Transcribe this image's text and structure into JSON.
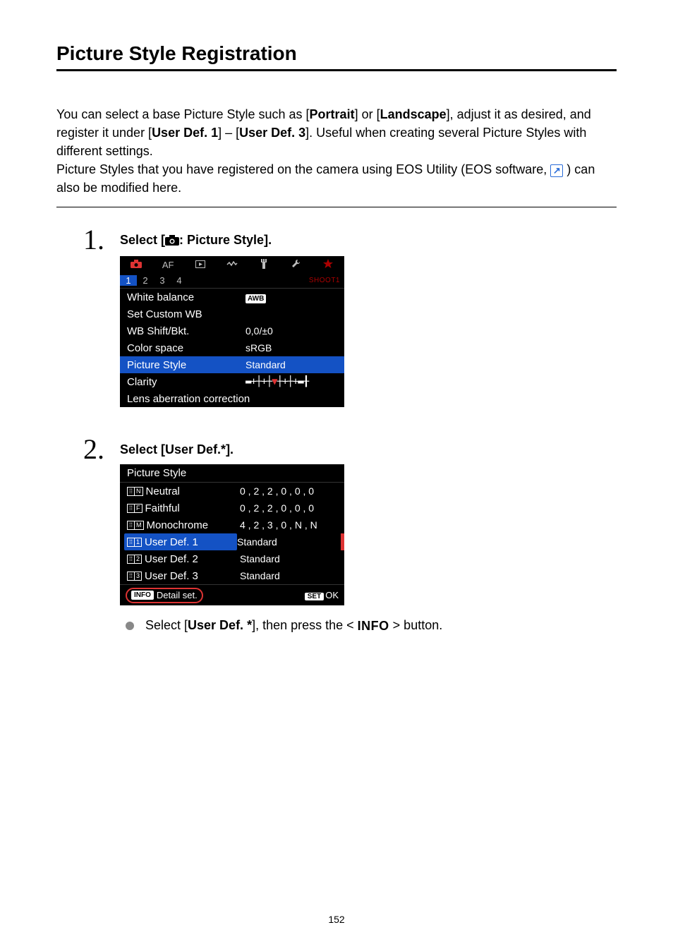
{
  "title": "Picture Style Registration",
  "intro": {
    "p1a": "You can select a base Picture Style such as [",
    "p1b": "Portrait",
    "p1c": "] or [",
    "p1d": "Landscape",
    "p1e": "], adjust it as desired, and register it under [",
    "p1f": "User Def. 1",
    "p1g": "] – [",
    "p1h": "User Def. 3",
    "p1i": "]. Useful when creating several Picture Styles with different settings.",
    "p2a": "Picture Styles that you have registered on the camera using EOS Utility (EOS software, ",
    "p2b": " ) can also be modified here."
  },
  "step1": {
    "num": "1.",
    "title_a": "Select [",
    "title_b": ": Picture Style]."
  },
  "lcd1": {
    "tabs": [
      "camera",
      "AF",
      "play",
      "wave",
      "plug",
      "wrench",
      "star"
    ],
    "subtabs": [
      "1",
      "2",
      "3",
      "4"
    ],
    "shoot": "SHOOT1",
    "rows": [
      {
        "label": "White balance",
        "value_type": "awb",
        "value": "AWB"
      },
      {
        "label": "Set Custom WB",
        "value_type": "none",
        "value": ""
      },
      {
        "label": "WB Shift/Bkt.",
        "value_type": "text",
        "value": "0,0/±0"
      },
      {
        "label": "Color space",
        "value_type": "text",
        "value": "sRGB"
      },
      {
        "label": "Picture Style",
        "value_type": "text",
        "value": "Standard",
        "selected": true
      },
      {
        "label": "Clarity",
        "value_type": "slider",
        "value": ""
      },
      {
        "label": "Lens aberration correction",
        "value_type": "none",
        "value": ""
      }
    ]
  },
  "step2": {
    "num": "2.",
    "title": "Select [User Def.*]."
  },
  "lcd2": {
    "title": "Picture Style",
    "rows": [
      {
        "badge": "N",
        "label": "Neutral",
        "value": "0 , 2 , 2 , 0 , 0 , 0"
      },
      {
        "badge": "F",
        "label": "Faithful",
        "value": "0 , 2 , 2 , 0 , 0 , 0"
      },
      {
        "badge": "M",
        "label": "Monochrome",
        "value": "4 , 2 , 3 , 0 , N , N"
      },
      {
        "badge": "1",
        "label": "User Def. 1",
        "value": "Standard",
        "selected": true
      },
      {
        "badge": "2",
        "label": "User Def. 2",
        "value": "Standard"
      },
      {
        "badge": "3",
        "label": "User Def. 3",
        "value": "Standard"
      }
    ],
    "btn_info": "INFO",
    "btn_detail": "Detail set.",
    "btn_set": "SET",
    "btn_ok": "OK"
  },
  "bullet": {
    "a": "Select [",
    "b": "User Def. *",
    "c": "], then press the < ",
    "d": "INFO",
    "e": " > button."
  },
  "pagenum": "152"
}
